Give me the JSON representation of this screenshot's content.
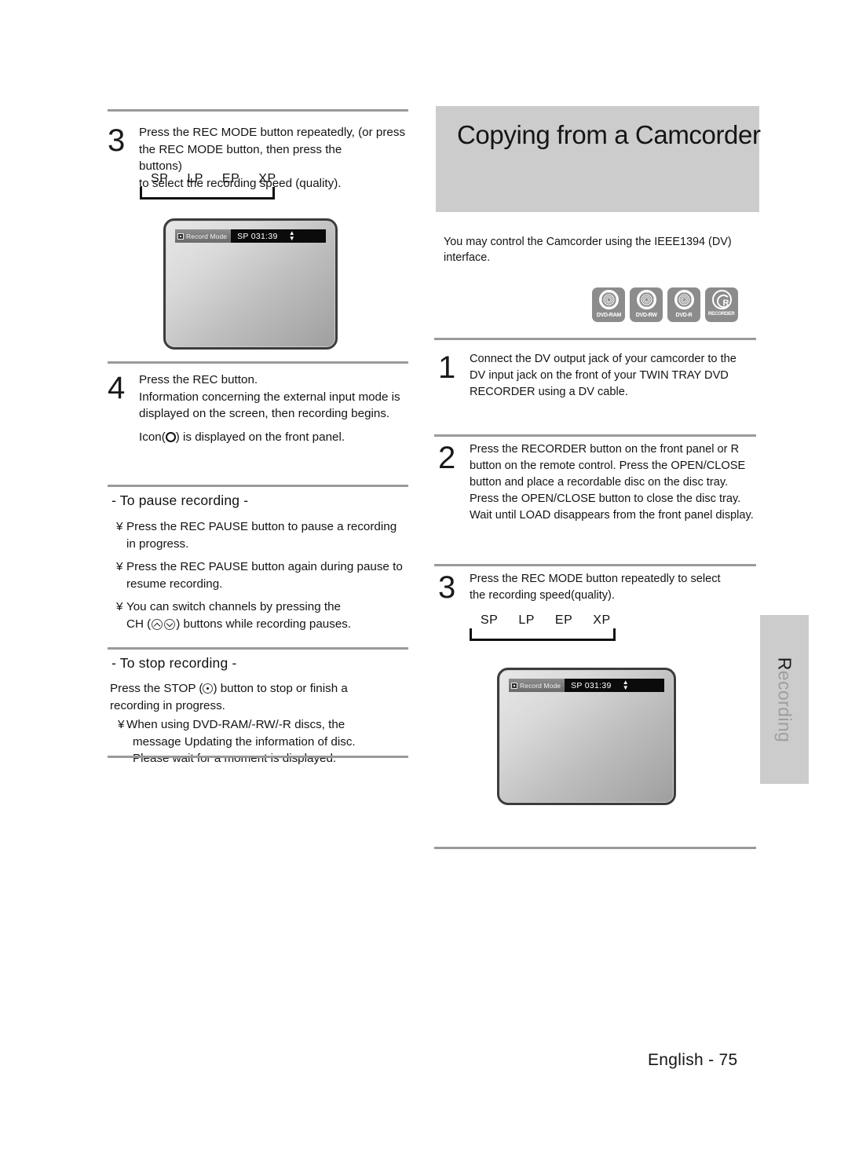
{
  "page": {
    "footer": "English - 75",
    "side_tab": {
      "first_letter": "R",
      "rest": "ecording"
    }
  },
  "left_column": {
    "step3": {
      "number": "3",
      "line1": "Press the REC MODE button repeatedly, (or press",
      "line2_a": "the REC MODE button, then press the",
      "line2_b": "buttons)",
      "line3": "to select the recording speed (quality)."
    },
    "rec_modes": [
      "SP",
      "LP",
      "EP",
      "XP"
    ],
    "tv_osd": {
      "label": "Record Mode",
      "value": "SP 031:39",
      "arrow_up": "▲",
      "arrow_down": "▼"
    },
    "step4": {
      "number": "4",
      "line1": "Press the REC button.",
      "line2": "Information concerning the external input mode is",
      "line3": "displayed on the screen, then recording begins.",
      "line4_a": "Icon(",
      "line4_b": ") is displayed on the front panel."
    },
    "pause_section": {
      "heading": "- To pause recording -",
      "bullet_mark": "¥",
      "bullets": [
        "Press the REC PAUSE button to pause a recording in progress.",
        "Press the REC PAUSE button again during pause to resume recording.",
        "You can switch channels by pressing the"
      ],
      "bullet3_line2_a": "CH (",
      "bullet3_line2_b": ") buttons while recording pauses."
    },
    "stop_section": {
      "heading": "- To stop recording -",
      "intro_a": "Press the STOP (",
      "intro_b": ") button to stop or finish a",
      "intro_line2": "recording in progress.",
      "bullet_mark": "¥",
      "bullet_line1": "When using DVD-RAM/-RW/-R discs, the",
      "bullet_line2": "message  Updating the information of disc.",
      "bullet_line3": "Please wait for a moment  is displayed."
    }
  },
  "right_column": {
    "title": "Copying from a Camcorder",
    "intro": "You may control the Camcorder using the IEEE1394 (DV) interface.",
    "disc_logos": [
      {
        "caption": "DVD-RAM",
        "kind": "disc"
      },
      {
        "caption": "DVD-RW",
        "kind": "disc"
      },
      {
        "caption": "DVD-R",
        "kind": "disc"
      },
      {
        "caption": "RECORDER",
        "kind": "recorder"
      }
    ],
    "step1": {
      "number": "1",
      "line1": "Connect the DV output jack of your camcorder to the",
      "line2": "DV input jack on the front of your TWIN TRAY DVD",
      "line3": "RECORDER using a DV cable."
    },
    "step2": {
      "number": "2",
      "line1": "Press the RECORDER button on the front panel or R",
      "line2": "button on the remote control. Press the OPEN/CLOSE",
      "line3": "button and place a recordable disc on the disc tray.",
      "line4": "Press the OPEN/CLOSE button to close the disc tray.",
      "line5": "Wait until LOAD disappears from the front panel display."
    },
    "step3": {
      "number": "3",
      "line1": "Press the REC MODE button repeatedly to select",
      "line2": "the recording speed(quality)."
    },
    "rec_modes": [
      "SP",
      "LP",
      "EP",
      "XP"
    ],
    "tv_osd": {
      "label": "Record Mode",
      "value": "SP 031:39",
      "arrow_up": "▲",
      "arrow_down": "▼"
    }
  }
}
